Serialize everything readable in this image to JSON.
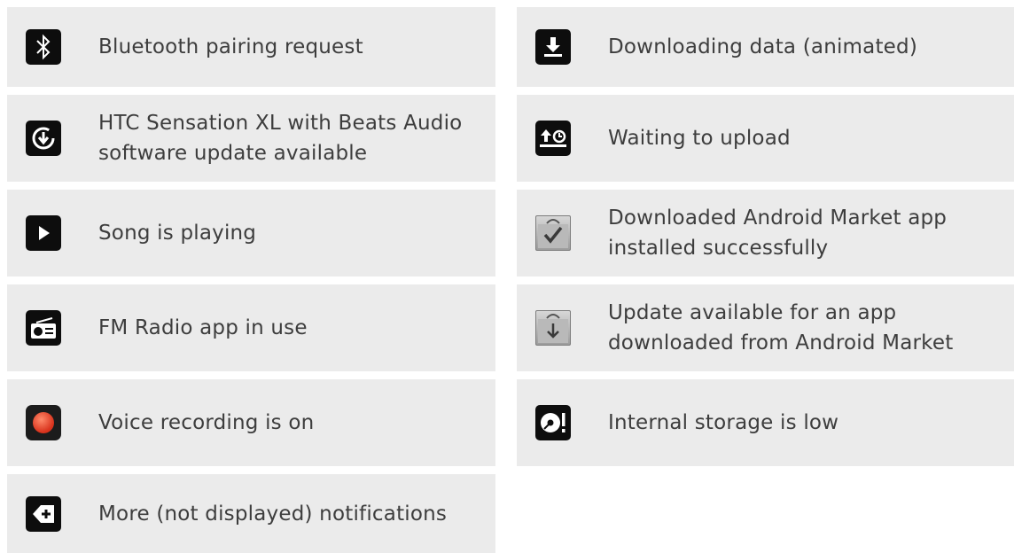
{
  "left": [
    {
      "icon": "bluetooth-icon",
      "text": "Bluetooth pairing request"
    },
    {
      "icon": "software-update-icon",
      "text": "HTC Sensation XL with Beats Audio software update available"
    },
    {
      "icon": "play-icon",
      "text": "Song is playing"
    },
    {
      "icon": "radio-icon",
      "text": "FM Radio app in use"
    },
    {
      "icon": "recording-icon",
      "text": "Voice recording is on"
    },
    {
      "icon": "more-notifications-icon",
      "text": "More (not displayed) notifications"
    }
  ],
  "right": [
    {
      "icon": "download-icon",
      "text": "Downloading data (animated)"
    },
    {
      "icon": "waiting-upload-icon",
      "text": "Waiting to upload"
    },
    {
      "icon": "market-installed-icon",
      "text": "Downloaded Android Market app installed successfully"
    },
    {
      "icon": "market-update-icon",
      "text": "Update available for an app downloaded from Android Market"
    },
    {
      "icon": "storage-low-icon",
      "text": "Internal storage is low"
    }
  ],
  "colors": {
    "card": "#ebebeb",
    "icon_bg": "#0d0d0d",
    "text": "#3d3d3d",
    "recording": "#e8412c"
  }
}
